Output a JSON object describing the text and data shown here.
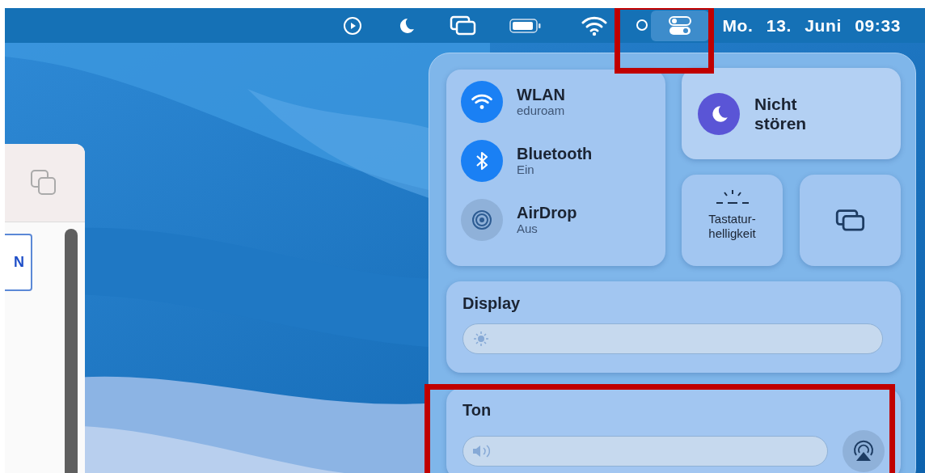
{
  "menu_bar": {
    "clock": "Mo. 13. Juni 09:33",
    "control_center_button": {
      "selected": true
    }
  },
  "partial_window": {
    "button_text": "N"
  },
  "control_center": {
    "connectivity": [
      {
        "kind": "wifi",
        "name": "WLAN",
        "status": "eduroam",
        "on": true
      },
      {
        "kind": "bluetooth",
        "name": "Bluetooth",
        "status": "Ein",
        "on": true
      },
      {
        "kind": "airdrop",
        "name": "AirDrop",
        "status": "Aus",
        "on": false
      }
    ],
    "focus": {
      "label": "Nicht stören",
      "on": true
    },
    "keyboard_brightness": {
      "label": "Tastatur-helligkeit"
    },
    "display": {
      "title": "Display",
      "level": 0
    },
    "sound": {
      "title": "Ton",
      "level": 0
    }
  }
}
